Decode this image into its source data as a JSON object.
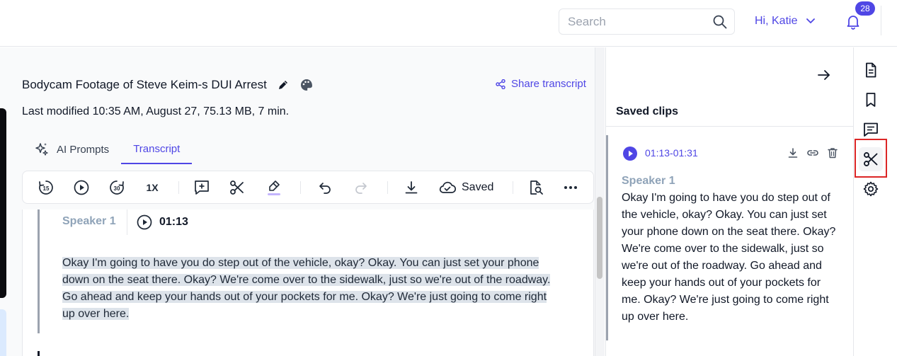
{
  "header": {
    "search_placeholder": "Search",
    "greeting": "Hi, Katie",
    "notification_count": "28"
  },
  "document": {
    "title": "Bodycam Footage of Steve Keim-s DUI Arrest",
    "share_label": "Share transcript",
    "meta": "Last modified 10:35 AM, August 27, 75.13 MB, 7 min."
  },
  "tabs": [
    {
      "label": "AI Prompts",
      "icon": "sparkle-icon",
      "active": false
    },
    {
      "label": "Transcript",
      "active": true
    }
  ],
  "toolbar": {
    "items": [
      "rewind-15-icon",
      "play-icon",
      "forward-30-icon",
      "speed",
      "add-comment-icon",
      "scissors-icon",
      "highlighter-icon",
      "undo-icon",
      "redo-icon",
      "download-icon",
      "cloud-saved-icon",
      "search-document-icon",
      "more-icon"
    ],
    "speed_label": "1X",
    "saved_label": "Saved"
  },
  "transcript": {
    "segments": [
      {
        "speaker": "Speaker 1",
        "time": "01:13",
        "text": "Okay I'm going to have you do step out of the vehicle, okay? Okay. You can just set your phone down on the seat there. Okay? We're come over to the sidewalk, just so we're out of the roadway. Go ahead and keep your hands out of your pockets for me. Okay? We're just going to come right up over here."
      }
    ]
  },
  "saved_clips": {
    "title": "Saved clips",
    "clips": [
      {
        "range": "01:13-01:31",
        "speaker": "Speaker 1",
        "text": "Okay I'm going to have you do step out of the vehicle, okay? Okay. You can just set your phone down on the seat there. Okay? We're come over to the sidewalk, just so we're out of the roadway. Go ahead and keep your hands out of your pockets for me. Okay? We're just going to come right up over here."
      }
    ]
  },
  "rail": {
    "items": [
      "document-icon",
      "bookmark-icon",
      "comments-icon",
      "scissors-icon",
      "settings-icon"
    ],
    "active": "scissors-icon"
  },
  "colors": {
    "accent": "#4f46e5",
    "highlight": "#dde3ea",
    "speaker": "#8fa3b8",
    "active_outline": "#dc2626"
  }
}
